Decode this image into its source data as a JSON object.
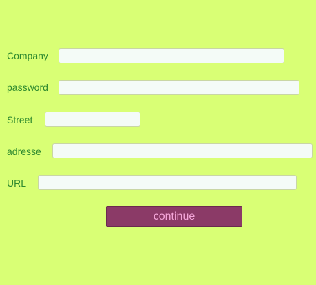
{
  "form": {
    "fields": [
      {
        "label": "Company",
        "value": "",
        "placeholder": ""
      },
      {
        "label": "password",
        "value": "",
        "placeholder": ""
      },
      {
        "label": "Street",
        "value": "",
        "placeholder": ""
      },
      {
        "label": "adresse",
        "value": "",
        "placeholder": ""
      },
      {
        "label": "URL",
        "value": "",
        "placeholder": ""
      }
    ],
    "submit_label": "continue"
  },
  "colors": {
    "background": "#d9ff75",
    "label_text": "#2f8a2f",
    "input_background": "#f4fbf7",
    "input_border": "#c9d6a5",
    "button_background": "#8b3a67",
    "button_text": "#f4a6d9"
  }
}
